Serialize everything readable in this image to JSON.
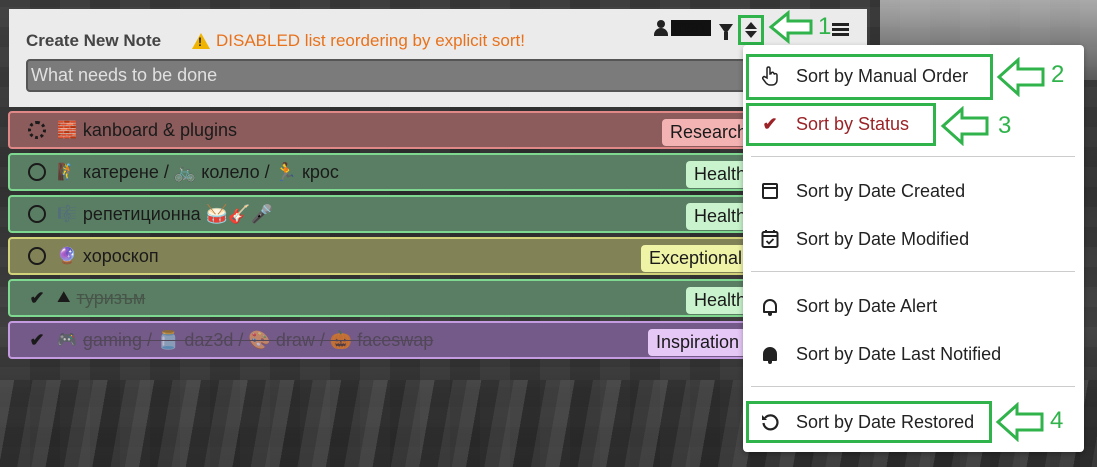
{
  "header": {
    "title": "Create New Note",
    "warning": "DISABLED list reordering by explicit sort!",
    "input_placeholder": "What needs to be done",
    "user_name": "man"
  },
  "todos": [
    {
      "status": "in-progress",
      "emoji": "🧱",
      "title": "kanboard & plugins",
      "tag": "Research",
      "row_color": "#8c5c5c",
      "border": "#e08888",
      "tag_color": "#f3b3b3"
    },
    {
      "status": "open",
      "emoji": "🧗",
      "title": "катерене / 🚲 колело / 🏃 крос",
      "tag": "Health",
      "row_color": "#5a7e63",
      "border": "#7fd890",
      "tag_color": "#c8f3cc"
    },
    {
      "status": "open",
      "emoji": "🎼",
      "title": "репетиционна 🥁🎸🎤",
      "tag": "Health",
      "row_color": "#5a7e63",
      "border": "#7fd890",
      "tag_color": "#c8f3cc"
    },
    {
      "status": "open",
      "emoji": "🔮",
      "title": "хороскоп",
      "tag": "Exceptional",
      "row_color": "#828257",
      "border": "#d2d27a",
      "tag_color": "#eff3a6"
    },
    {
      "status": "done",
      "emoji": "⛰",
      "title": "туризъм",
      "tag": "Health",
      "row_color": "#5a7e63",
      "border": "#7fd890",
      "tag_color": "#c8f3cc"
    },
    {
      "status": "done",
      "emoji": "🎮",
      "title": "gaming / 🫙 daz3d / 🎨 draw / 🎃 faceswap",
      "tag": "Inspiration",
      "row_color": "#745a88",
      "border": "#c49be0",
      "tag_color": "#e6c8f7"
    }
  ],
  "sort_menu": {
    "items": [
      {
        "label": "Sort by Manual Order",
        "icon": "hand-pointer-icon"
      },
      {
        "label": "Sort by Status",
        "icon": "check-icon",
        "active": true
      },
      {
        "label": "Sort by Date Created",
        "icon": "calendar-icon"
      },
      {
        "label": "Sort by Date Modified",
        "icon": "calendar-check-icon"
      },
      {
        "label": "Sort by Date Alert",
        "icon": "bell-outline-icon"
      },
      {
        "label": "Sort by Date Last Notified",
        "icon": "bell-solid-icon"
      },
      {
        "label": "Sort by Date Restored",
        "icon": "undo-icon"
      }
    ]
  },
  "annotations": [
    "1",
    "2",
    "3",
    "4"
  ],
  "colors": {
    "accent_green": "#2fb34a",
    "active_sort": "#9b2226",
    "warning": "#e8721c"
  }
}
